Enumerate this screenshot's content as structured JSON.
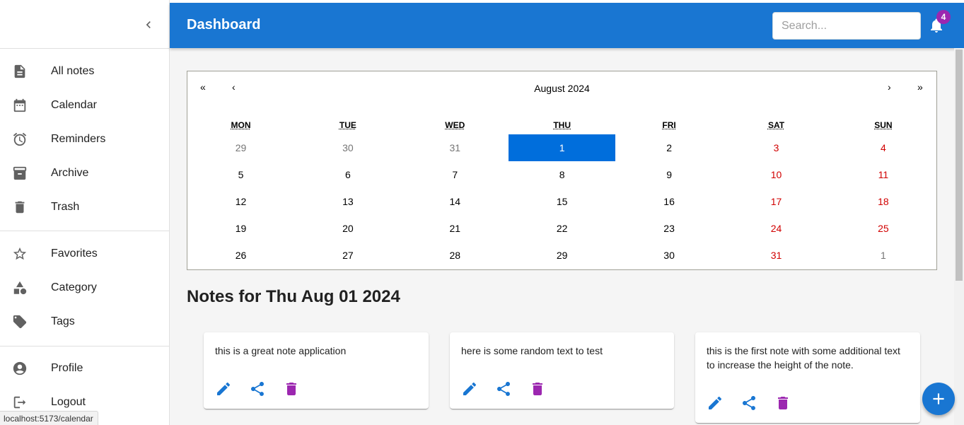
{
  "header": {
    "title": "Dashboard",
    "search_placeholder": "Search...",
    "notification_count": "4"
  },
  "sidebar": {
    "groups": [
      [
        {
          "label": "All notes",
          "icon": "note-icon"
        },
        {
          "label": "Calendar",
          "icon": "calendar-icon"
        },
        {
          "label": "Reminders",
          "icon": "alarm-icon"
        },
        {
          "label": "Archive",
          "icon": "archive-icon"
        },
        {
          "label": "Trash",
          "icon": "trash-icon"
        }
      ],
      [
        {
          "label": "Favorites",
          "icon": "star-icon"
        },
        {
          "label": "Category",
          "icon": "category-icon"
        },
        {
          "label": "Tags",
          "icon": "tag-icon"
        }
      ],
      [
        {
          "label": "Profile",
          "icon": "account-icon"
        },
        {
          "label": "Logout",
          "icon": "logout-icon"
        }
      ]
    ]
  },
  "calendar": {
    "nav": {
      "prev_year": "«",
      "prev_month": "‹",
      "next_month": "›",
      "next_year": "»"
    },
    "month_label": "August 2024",
    "weekdays": [
      "MON",
      "TUE",
      "WED",
      "THU",
      "FRI",
      "SAT",
      "SUN"
    ],
    "weeks": [
      [
        "29",
        "30",
        "31",
        "1",
        "2",
        "3",
        "4"
      ],
      [
        "5",
        "6",
        "7",
        "8",
        "9",
        "10",
        "11"
      ],
      [
        "12",
        "13",
        "14",
        "15",
        "16",
        "17",
        "18"
      ],
      [
        "19",
        "20",
        "21",
        "22",
        "23",
        "24",
        "25"
      ],
      [
        "26",
        "27",
        "28",
        "29",
        "30",
        "31",
        "1"
      ]
    ],
    "selected_date": "1"
  },
  "notes": {
    "title": "Notes for Thu Aug 01 2024",
    "items": [
      {
        "text": "this is a great note application"
      },
      {
        "text": "here is some random text to test"
      },
      {
        "text": "this is the first note with some additional text to increase the height of the note."
      }
    ]
  },
  "status_bar": {
    "url": "localhost:5173/calendar"
  },
  "colors": {
    "primary": "#1976d2",
    "badge": "#9c27b0",
    "selected_day": "#006edc",
    "weekend": "#d10000",
    "delete_icon": "#9c27b0"
  }
}
